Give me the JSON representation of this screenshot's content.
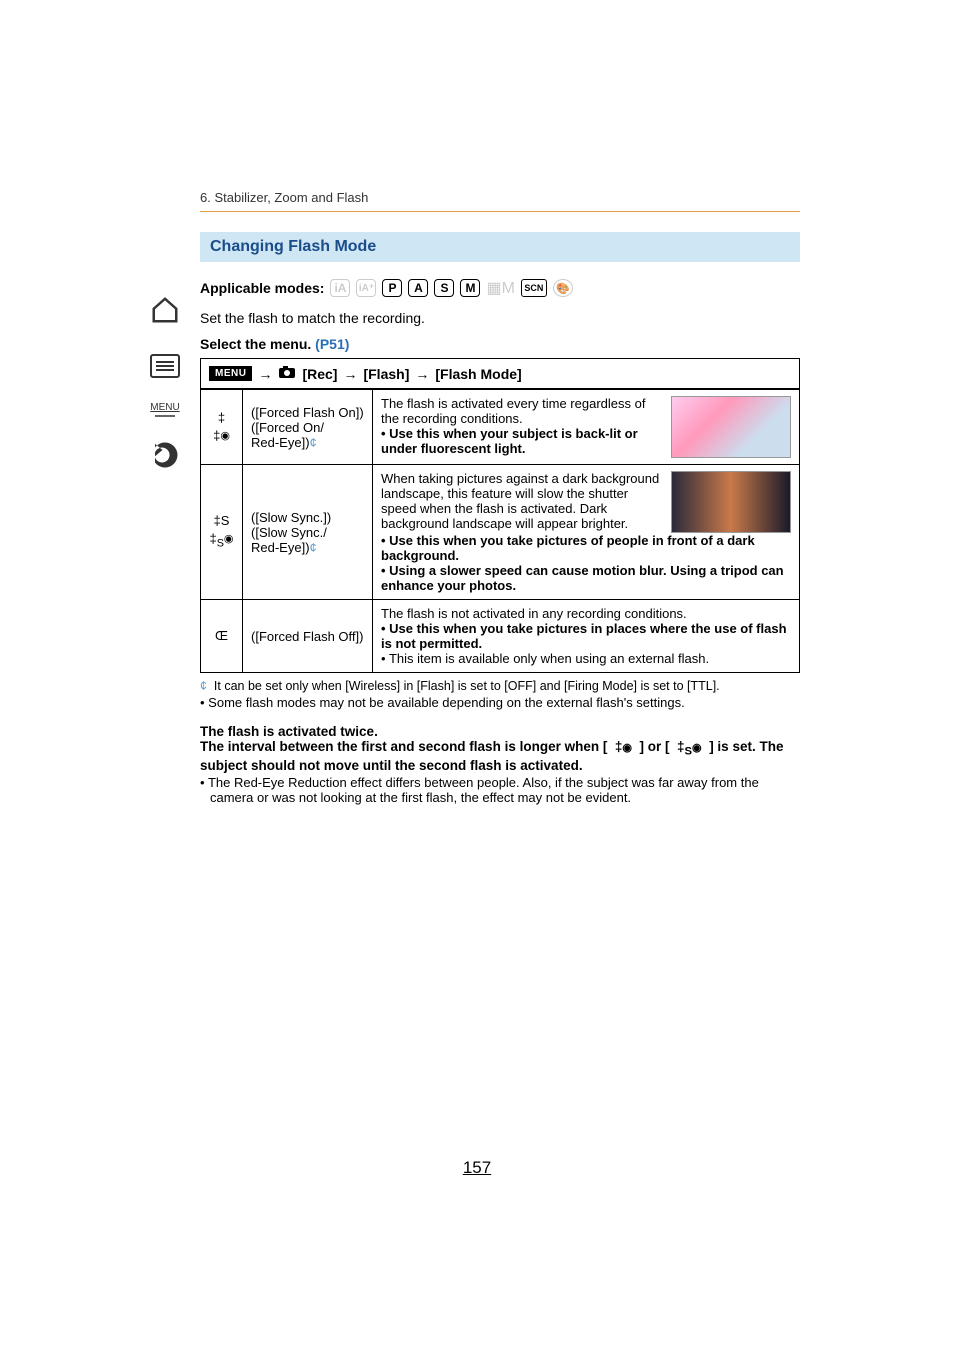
{
  "breadcrumb": "6. Stabilizer, Zoom and Flash",
  "section_title": "Changing Flash Mode",
  "applicable_label": "Applicable modes:",
  "modes": {
    "p": "P",
    "a": "A",
    "s": "S",
    "m": "M",
    "scn": "SCN"
  },
  "intro": "Set the flash to match the recording.",
  "select_menu_label": "Select the menu.",
  "select_menu_link": "(P51)",
  "menu_path": {
    "badge": "MENU",
    "arrow": "→",
    "rec": "[Rec]",
    "flash": "[Flash]",
    "mode": "[Flash Mode]"
  },
  "rows": [
    {
      "icons": [
        "‡",
        "‡◉"
      ],
      "labels": "([Forced Flash On])\n([Forced On/Red-Eye])",
      "desc_plain": "The flash is activated every time regardless of the recording conditions.",
      "desc_bold": "Use this when your subject is back-lit or under fluorescent light."
    },
    {
      "icons": [
        "‡S",
        "‡S◉"
      ],
      "labels": "([Slow Sync.])\n([Slow Sync./Red-Eye])",
      "desc_plain": "When taking pictures against a dark background landscape, this feature will slow the shutter speed when the flash is activated. Dark background landscape will appear brighter.",
      "desc_bold1": "Use this when you take pictures of people in front of a dark background.",
      "desc_bold2": "Using a slower speed can cause motion blur. Using a tripod can enhance your photos."
    },
    {
      "icons": [
        "Œ"
      ],
      "labels": "([Forced Flash Off])",
      "desc_plain": "The flash is not activated in any recording conditions.",
      "desc_bold": "Use this when you take pictures in places where the use of flash is not permitted.",
      "desc_note": "This item is available only when using an external flash."
    }
  ],
  "footnote_star": "¢",
  "footnote": "It can be set only when [Wireless] in [Flash] is set to [OFF] and [Firing Mode] is set to [TTL].",
  "note": "Some flash modes may not be available depending on the external flash's settings.",
  "para": {
    "l1": "The flash is activated twice.",
    "l2a": "The interval between the first and second flash is longer when [",
    "l2b": "] or [",
    "l2c": "] is set. The subject should not move until the second flash is activated.",
    "bullet": "The Red-Eye Reduction effect differs between people. Also, if the subject was far away from the camera or was not looking at the first flash, the effect may not be evident."
  },
  "sidebar_menu": "MENU",
  "page": "157"
}
